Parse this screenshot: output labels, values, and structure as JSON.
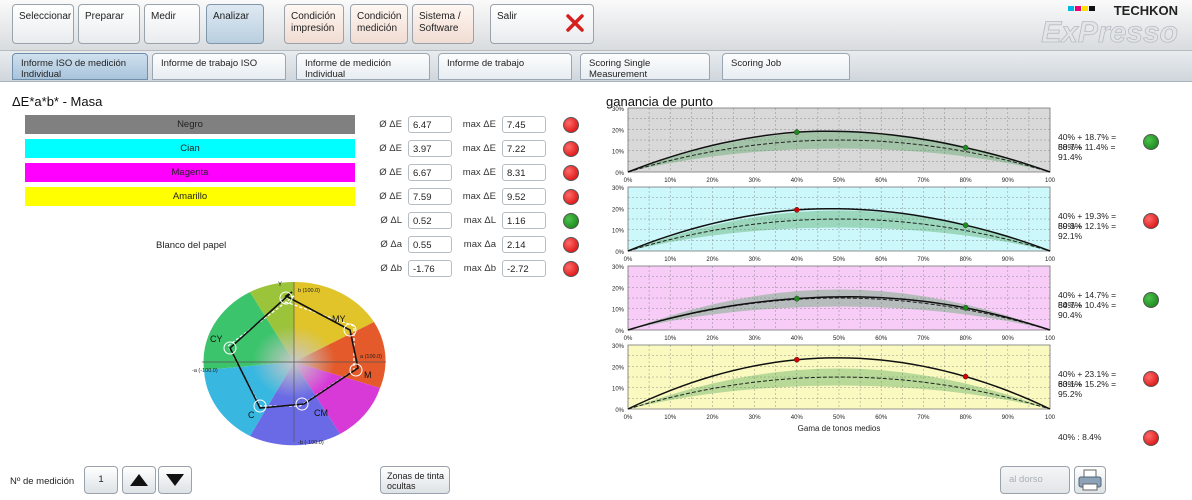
{
  "top_tabs": [
    {
      "label": "Seleccionar"
    },
    {
      "label": "Preparar"
    },
    {
      "label": "Medir"
    },
    {
      "label": "Analizar"
    },
    {
      "label": "Condición\nimpresión"
    },
    {
      "label": "Condición\nmedición"
    },
    {
      "label": "Sistema /\nSoftware"
    },
    {
      "label": "Salir"
    }
  ],
  "brand": {
    "name": "TECHKON",
    "product": "ExPresso"
  },
  "sub_tabs": [
    {
      "label": "Informe ISO de medición\nIndividual"
    },
    {
      "label": "Informe de trabajo ISO"
    },
    {
      "label": "Informe de medición\nIndividual"
    },
    {
      "label": "Informe de trabajo"
    },
    {
      "label": "Scoring Single\nMeasurement"
    },
    {
      "label": "Scoring Job"
    }
  ],
  "left": {
    "title": "ΔE*a*b* - Masa",
    "swatches": [
      {
        "label": "Negro",
        "color": "#808080"
      },
      {
        "label": "Cian",
        "color": "#00ffff"
      },
      {
        "label": "Magenta",
        "color": "#ff00ff"
      },
      {
        "label": "Amarillo",
        "color": "#ffff00"
      }
    ],
    "paper_label": "Blanco del papel",
    "metrics": [
      {
        "avg_label": "Ø ΔE",
        "avg": "6.47",
        "max_label": "max ΔE",
        "max": "7.45",
        "status": "red"
      },
      {
        "avg_label": "Ø ΔE",
        "avg": "3.97",
        "max_label": "max ΔE",
        "max": "7.22",
        "status": "red"
      },
      {
        "avg_label": "Ø ΔE",
        "avg": "6.67",
        "max_label": "max ΔE",
        "max": "8.31",
        "status": "red"
      },
      {
        "avg_label": "Ø ΔE",
        "avg": "7.59",
        "max_label": "max ΔE",
        "max": "9.52",
        "status": "red"
      },
      {
        "avg_label": "Ø ΔL",
        "avg": "0.52",
        "max_label": "max ΔL",
        "max": "1.16",
        "status": "green"
      },
      {
        "avg_label": "Ø Δa",
        "avg": "0.55",
        "max_label": "max Δa",
        "max": "2.14",
        "status": "red"
      },
      {
        "avg_label": "Ø Δb",
        "avg": "-1.76",
        "max_label": "max Δb",
        "max": "-2.72",
        "status": "red"
      }
    ],
    "color_wheel": {
      "labels": {
        "y": "Y",
        "my": "MY",
        "m": "M",
        "cm": "CM",
        "c": "C",
        "cy": "CY",
        "top": "b (100.0)",
        "bottom": "-b (-100.0)",
        "left": "-a (-100.0)",
        "right": "a (100.0)"
      }
    }
  },
  "right": {
    "title": "ganancia de punto",
    "y_ticks": [
      "30%",
      "20%",
      "10%",
      "0%"
    ],
    "x_ticks": [
      "0%",
      "10%",
      "20%",
      "30%",
      "40%",
      "50%",
      "60%",
      "70%",
      "80%",
      "90%",
      "100"
    ],
    "xlabel": "Gama de tonos medios",
    "summary": "40% : 8.4%",
    "summary_status": "red"
  },
  "chart_data": [
    {
      "type": "line",
      "name": "Negro",
      "bg": "#d9d9d9",
      "x": [
        0,
        40,
        80,
        100
      ],
      "values": [
        0,
        18.7,
        11.4,
        0
      ],
      "ylim": [
        0,
        30
      ],
      "points": [
        {
          "x": 40,
          "y": 18.7,
          "color": "#1c8c1c"
        },
        {
          "x": 80,
          "y": 11.4,
          "color": "#1c8c1c"
        }
      ],
      "text": [
        "40% + 18.7% = 58.7%",
        "80% + 11.4% = 91.4%"
      ],
      "status": "green"
    },
    {
      "type": "line",
      "name": "Cian",
      "bg": "#ccf7fb",
      "x": [
        0,
        40,
        80,
        100
      ],
      "values": [
        0,
        19.3,
        12.1,
        0
      ],
      "ylim": [
        0,
        30
      ],
      "points": [
        {
          "x": 40,
          "y": 19.3,
          "color": "#d40000"
        },
        {
          "x": 80,
          "y": 12.1,
          "color": "#1c8c1c"
        }
      ],
      "text": [
        "40% + 19.3% = 59.3%",
        "80% + 12.1% = 92.1%"
      ],
      "status": "red"
    },
    {
      "type": "line",
      "name": "Magenta",
      "bg": "#f7ccf7",
      "x": [
        0,
        40,
        80,
        100
      ],
      "values": [
        0,
        14.7,
        10.4,
        0
      ],
      "ylim": [
        0,
        30
      ],
      "points": [
        {
          "x": 40,
          "y": 14.7,
          "color": "#1c8c1c"
        },
        {
          "x": 80,
          "y": 10.4,
          "color": "#1c8c1c"
        }
      ],
      "text": [
        "40% + 14.7% = 54.7%",
        "80% + 10.4% = 90.4%"
      ],
      "status": "green"
    },
    {
      "type": "line",
      "name": "Amarillo",
      "bg": "#fafac0",
      "x": [
        0,
        40,
        80,
        100
      ],
      "values": [
        0,
        23.1,
        15.2,
        0
      ],
      "ylim": [
        0,
        30
      ],
      "points": [
        {
          "x": 40,
          "y": 23.1,
          "color": "#d40000"
        },
        {
          "x": 80,
          "y": 15.2,
          "color": "#d40000"
        }
      ],
      "text": [
        "40% + 23.1% = 63.1%",
        "80% + 15.2% = 95.2%"
      ],
      "status": "red"
    }
  ],
  "bottom": {
    "measurement_label": "Nº de medición",
    "measurement_value": "1",
    "hidden_zones_label": "Zonas de tinta\nocultas",
    "back_label": "al dorso"
  }
}
